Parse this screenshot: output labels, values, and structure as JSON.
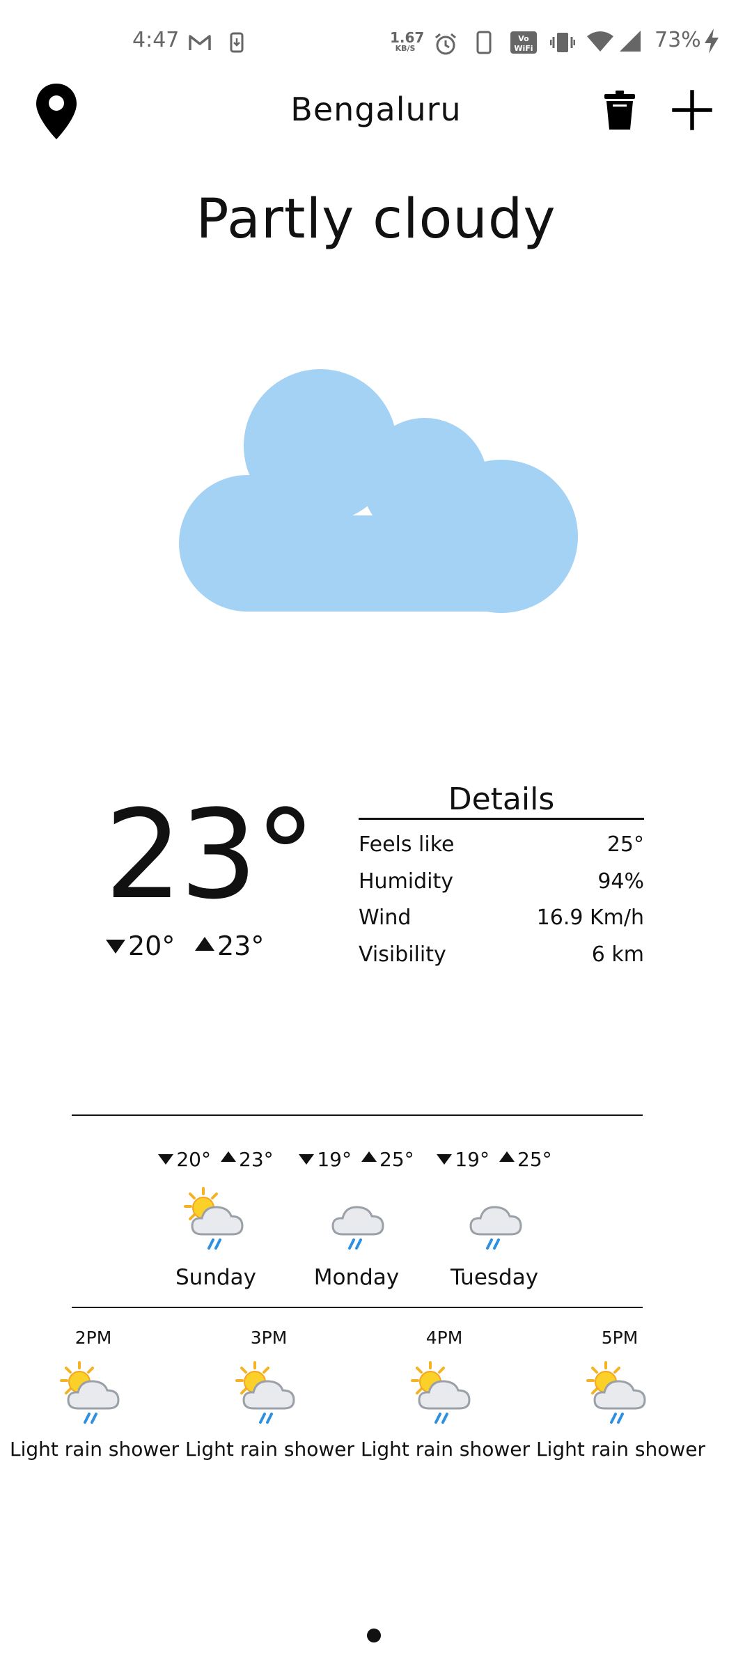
{
  "status_bar": {
    "time": "4:47",
    "net_speed_value": "1.67",
    "net_speed_unit": "KB/S",
    "battery": "73%",
    "icons": [
      "gmail-icon",
      "sim-storage-icon",
      "alarm-icon",
      "phone-icon",
      "vowifi-icon",
      "vibrate-icon",
      "wifi-icon",
      "signal-icon",
      "charging-icon"
    ]
  },
  "header": {
    "city": "Bengaluru",
    "icons": {
      "location": "location-pin-icon",
      "delete": "trash-icon",
      "add": "plus-icon"
    }
  },
  "current": {
    "condition": "Partly cloudy",
    "temperature": "23°",
    "low": "20°",
    "high": "23°",
    "icon": "cloud-icon",
    "cloud_color": "#a4d2f5"
  },
  "details": {
    "title": "Details",
    "rows": [
      {
        "label": "Feels like",
        "value": "25°"
      },
      {
        "label": "Humidity",
        "value": "94%"
      },
      {
        "label": "Wind",
        "value": "16.9 Km/h"
      },
      {
        "label": "Visibility",
        "value": "6 km"
      }
    ]
  },
  "daily": [
    {
      "day": "Sunday",
      "low": "20°",
      "high": "23°",
      "icon": "sun-cloud-rain-icon"
    },
    {
      "day": "Monday",
      "low": "19°",
      "high": "25°",
      "icon": "cloud-rain-icon"
    },
    {
      "day": "Tuesday",
      "low": "19°",
      "high": "25°",
      "icon": "cloud-rain-icon"
    }
  ],
  "hourly": [
    {
      "time": "2PM",
      "description": "Light rain shower",
      "icon": "sun-cloud-rain-icon"
    },
    {
      "time": "3PM",
      "description": "Light rain shower",
      "icon": "sun-cloud-rain-icon"
    },
    {
      "time": "4PM",
      "description": "Light rain shower",
      "icon": "sun-cloud-rain-icon"
    },
    {
      "time": "5PM",
      "description": "Light rain shower",
      "icon": "sun-cloud-rain-icon"
    }
  ],
  "pager": {
    "icon": "page-indicator-dot"
  }
}
